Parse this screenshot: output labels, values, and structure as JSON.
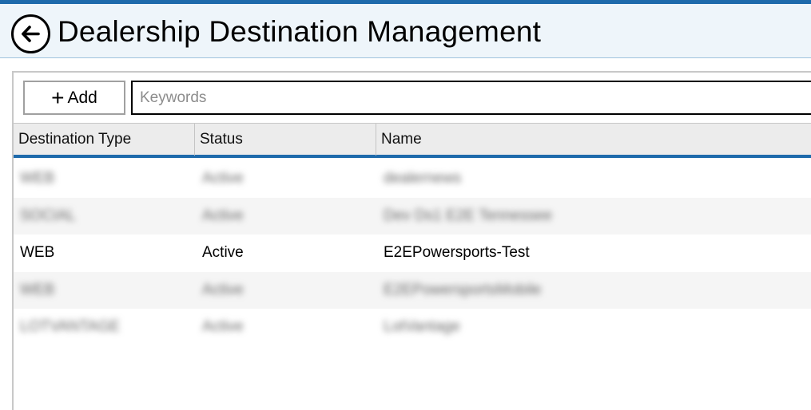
{
  "header": {
    "title": "Dealership Destination Management",
    "back_icon": "arrow-left-circle-icon"
  },
  "toolbar": {
    "add_label": "Add",
    "add_icon": "plus-icon",
    "search_placeholder": "Keywords",
    "search_value": ""
  },
  "table": {
    "columns": [
      "Destination Type",
      "Status",
      "Name"
    ],
    "rows": [
      {
        "type": "WEB",
        "status": "Active",
        "name": "dealernews",
        "blurred": true
      },
      {
        "type": "SOCIAL",
        "status": "Active",
        "name": "Dev Ds1 E2E Tennessee",
        "blurred": true
      },
      {
        "type": "WEB",
        "status": "Active",
        "name": "E2EPowersports-Test",
        "blurred": false
      },
      {
        "type": "WEB",
        "status": "Active",
        "name": "E2EPowersportsMobile",
        "blurred": true
      },
      {
        "type": "LOTVANTAGE",
        "status": "Active",
        "name": "LotVantage",
        "blurred": true
      }
    ]
  },
  "colors": {
    "accent": "#1e6aab",
    "header_bg": "#eef5fa",
    "column_header_bg": "#ececec",
    "alt_row_bg": "#f5f5f5"
  }
}
